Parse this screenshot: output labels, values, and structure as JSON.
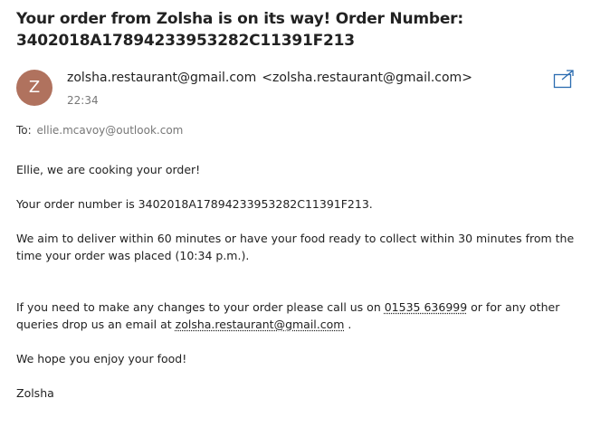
{
  "email": {
    "subject": "Your order from Zolsha is on its way! Order Number: 3402018A17894233953282C11391F213",
    "avatar_letter": "Z",
    "avatar_color": "#b0725e",
    "sender_name": "zolsha.restaurant@gmail.com",
    "sender_address": "<zolsha.restaurant@gmail.com>",
    "time": "22:34",
    "to_label": "To:",
    "to_address": "ellie.mcavoy@outlook.com",
    "popout_icon": "open-in-new-window-icon"
  },
  "body": {
    "greeting": "Ellie, we are cooking your order!",
    "order_number_line": "Your order number is 3402018A17894233953282C11391F213.",
    "delivery_line": "We aim to deliver within 60 minutes or have your food ready to collect within 30 minutes from the time your order was placed (10:34 p.m.).",
    "contact_part1": "If you need to make any changes to your order please call us on ",
    "phone": "01535 636999",
    "contact_part2": " or for any other queries drop us an email at ",
    "email_link": "zolsha.restaurant@gmail.com",
    "contact_part3": " .",
    "enjoy_line": "We hope you enjoy your food!",
    "signature": "Zolsha"
  }
}
